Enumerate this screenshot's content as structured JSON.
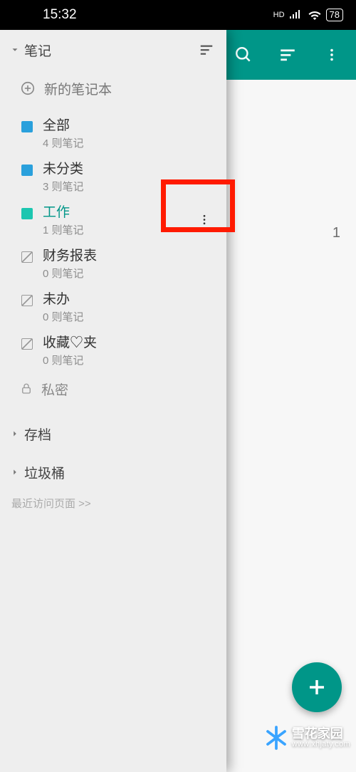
{
  "statusbar": {
    "time": "15:32",
    "hd": "HD",
    "battery": "78"
  },
  "drawer": {
    "section_notes": "笔记",
    "new_notebook": "新的笔记本",
    "items": [
      {
        "name": "全部",
        "count": "4 则笔记",
        "color": "#2aa0dc",
        "kind": "color"
      },
      {
        "name": "未分类",
        "count": "3 则笔记",
        "color": "#2aa0dc",
        "kind": "color"
      },
      {
        "name": "工作",
        "count": "1 则笔记",
        "color": "#1cc6b0",
        "kind": "color",
        "active": true
      },
      {
        "name": "财务报表",
        "count": "0 则笔记",
        "kind": "outline"
      },
      {
        "name": "未办",
        "count": "0 则笔记",
        "kind": "outline"
      },
      {
        "name": "收藏♡夹",
        "count": "0 则笔记",
        "kind": "outline"
      }
    ],
    "private": "私密",
    "archive": "存档",
    "trash": "垃圾桶",
    "recent": "最近访问页面 >>"
  },
  "main": {
    "page_count": "1"
  },
  "watermark": {
    "line1": "雪花家园",
    "line2": "www.xhjaty.com"
  }
}
